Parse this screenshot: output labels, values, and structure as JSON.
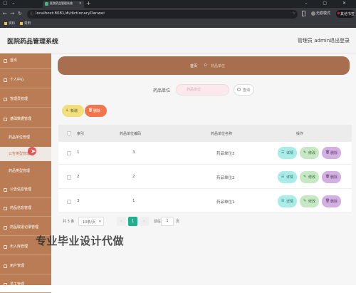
{
  "browser": {
    "tab_title": "医院药品管理系统",
    "url": "localhost:8081/#/dictionaryDanwei",
    "profile_label": "无痕模式",
    "extension_label": "其他书签",
    "bookmarks": [
      "资料",
      "常用"
    ]
  },
  "header": {
    "title": "医院药品管理系统",
    "user_label": "管理员 admin",
    "logout_label": "退出登录"
  },
  "sidebar": {
    "items": [
      {
        "label": "首页"
      },
      {
        "label": "个人中心"
      },
      {
        "label": "管理员管理"
      },
      {
        "label": "基础数据管理"
      }
    ],
    "subitems": [
      {
        "label": "药品单位管理"
      },
      {
        "label": "公告类型管理"
      },
      {
        "label": "药品类型管理"
      }
    ],
    "items_after": [
      {
        "label": "公告信息管理"
      },
      {
        "label": "药品信息管理"
      },
      {
        "label": "药品取退记录管理"
      },
      {
        "label": "出入库管理"
      },
      {
        "label": "用户管理"
      },
      {
        "label": "员工管理"
      }
    ]
  },
  "breadcrumb": {
    "home": "首页",
    "current": "药品单位"
  },
  "search": {
    "label": "药品单位",
    "placeholder": "药品单位",
    "button_label": "查询"
  },
  "toolbar": {
    "add_label": "新增",
    "delete_label": "删除"
  },
  "table": {
    "headers": [
      "索引",
      "药品单位编码",
      "药品单位名称",
      "操作"
    ],
    "rows": [
      {
        "index": "1",
        "code": "3",
        "name": "药品单位3"
      },
      {
        "index": "2",
        "code": "2",
        "name": "药品单位2"
      },
      {
        "index": "3",
        "code": "1",
        "name": "药品单位1"
      }
    ],
    "actions": {
      "detail": "详情",
      "edit": "修改",
      "delete": "删除"
    }
  },
  "pagination": {
    "total": "共 3 条",
    "page_size": "10条/页",
    "current_page": "1",
    "goto_label": "前往",
    "goto_value": "1",
    "page_suffix": "页"
  },
  "watermark": "专业毕业设计代做"
}
